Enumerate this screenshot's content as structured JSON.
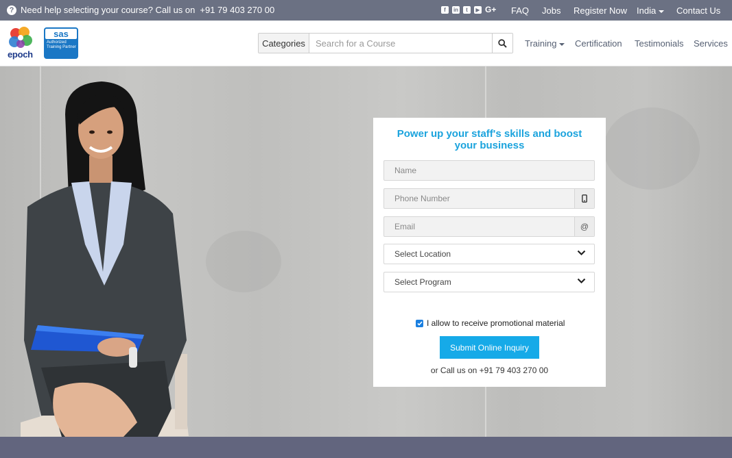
{
  "topbar": {
    "help_text": "Need help selecting your course? Call us on",
    "help_phone": "+91 79 403 270 00",
    "social_icons": [
      "facebook-icon",
      "linkedin-icon",
      "twitter-icon",
      "youtube-icon",
      "google-plus-icon"
    ],
    "links": {
      "faq": "FAQ",
      "jobs": "Jobs",
      "register": "Register Now",
      "country": "India",
      "contact": "Contact Us"
    }
  },
  "header": {
    "logo_text": "epoch",
    "sas_badge": "sas",
    "sas_sub": "Authorized Training Partner",
    "search": {
      "category_label": "Categories",
      "placeholder": "Search for a Course"
    },
    "nav": {
      "training": "Training",
      "certification": "Certification",
      "testimonials": "Testimonials",
      "services": "Services"
    }
  },
  "form": {
    "title": "Power up your staff's skills and boost your business",
    "name_placeholder": "Name",
    "phone_placeholder": "Phone Number",
    "email_placeholder": "Email",
    "email_addon": "@",
    "location_label": "Select Location",
    "program_label": "Select Program",
    "consent_label": "I allow to receive promotional material",
    "consent_checked": true,
    "submit_label": "Submit Online Inquiry",
    "call_text": "or Call us on +91 79 403 270 00"
  },
  "colors": {
    "topbar": "#6b7183",
    "accent": "#1ba3dd",
    "button": "#16aae8",
    "footer": "#62657e"
  }
}
